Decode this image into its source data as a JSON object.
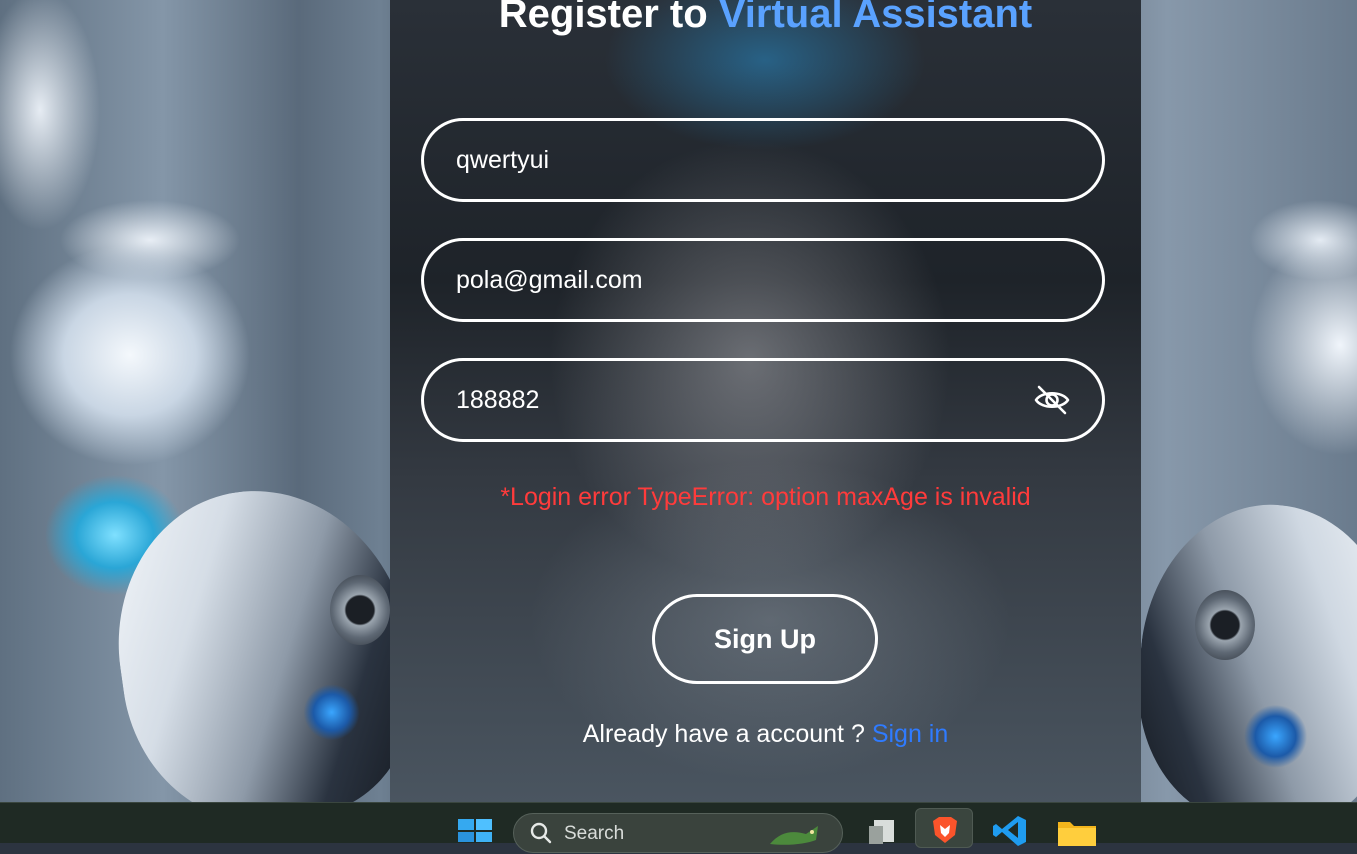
{
  "form": {
    "title_prefix": "Register to",
    "title_accent": "Virtual Assistant",
    "username_value": "qwertyui",
    "email_value": "pola@gmail.com",
    "password_value": "188882",
    "password_toggle_icon": "eye-off-icon",
    "error_message": "*Login error TypeError: option maxAge is invalid",
    "submit_label": "Sign Up",
    "account_prompt": "Already have a account ?",
    "signin_link": "Sign in"
  },
  "taskbar": {
    "search_label": "Search",
    "icons": [
      "windows-start-icon",
      "search-icon",
      "task-view-icon",
      "brave-browser-icon",
      "vscode-icon",
      "file-explorer-icon"
    ]
  },
  "colors": {
    "title_accent": "#5aa2ff",
    "error": "#ff3b3b",
    "link": "#2f7bff",
    "field_border": "#ffffff"
  }
}
